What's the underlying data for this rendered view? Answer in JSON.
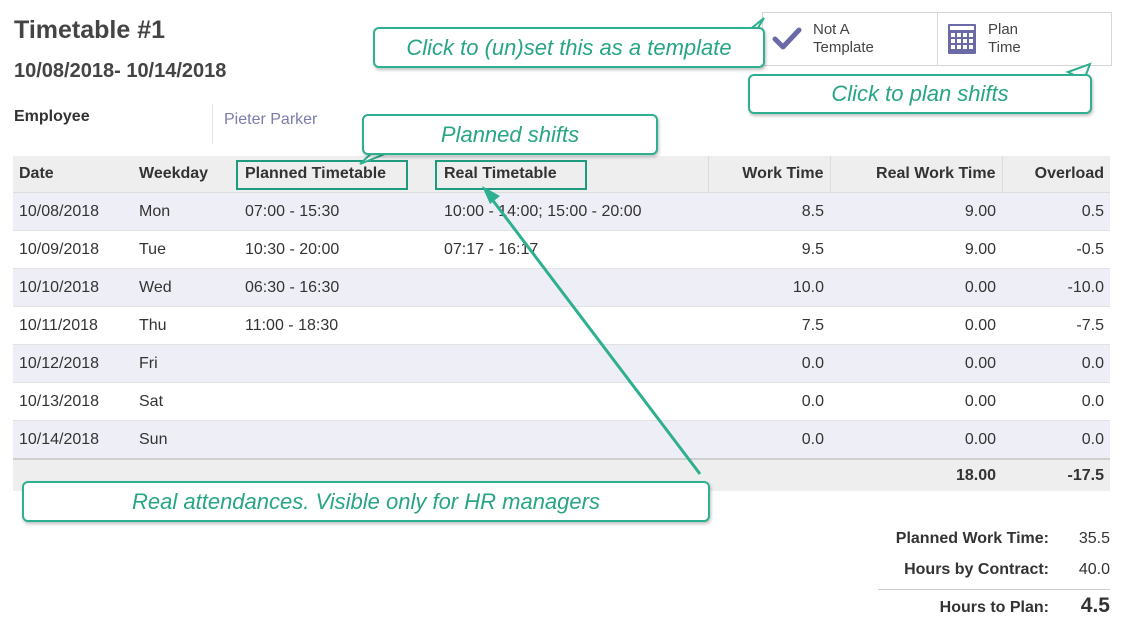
{
  "header": {
    "title": "Timetable #1",
    "date_range": "10/08/2018- 10/14/2018"
  },
  "employee": {
    "label": "Employee",
    "value": "Pieter Parker"
  },
  "buttons": {
    "template": {
      "line1": "Not A",
      "line2": "Template",
      "icon": "checkmark-icon"
    },
    "plan": {
      "line1": "Plan",
      "line2": "Time",
      "icon": "calendar-icon"
    }
  },
  "table": {
    "columns": [
      "Date",
      "Weekday",
      "Planned Timetable",
      "Real Timetable",
      "Work Time",
      "Real Work Time",
      "Overload"
    ],
    "rows": [
      [
        "10/08/2018",
        "Mon",
        "07:00 - 15:30",
        "10:00 - 14:00; 15:00 - 20:00",
        "8.5",
        "9.00",
        "0.5"
      ],
      [
        "10/09/2018",
        "Tue",
        "10:30 - 20:00",
        "07:17 - 16:17",
        "9.5",
        "9.00",
        "-0.5"
      ],
      [
        "10/10/2018",
        "Wed",
        "06:30 - 16:30",
        "",
        "10.0",
        "0.00",
        "-10.0"
      ],
      [
        "10/11/2018",
        "Thu",
        "11:00 - 18:30",
        "",
        "7.5",
        "0.00",
        "-7.5"
      ],
      [
        "10/12/2018",
        "Fri",
        "",
        "",
        "0.0",
        "0.00",
        "0.0"
      ],
      [
        "10/13/2018",
        "Sat",
        "",
        "",
        "0.0",
        "0.00",
        "0.0"
      ],
      [
        "10/14/2018",
        "Sun",
        "",
        "",
        "0.0",
        "0.00",
        "0.0"
      ]
    ],
    "totals": {
      "real_work_time": "18.00",
      "overload": "-17.5"
    }
  },
  "summary": {
    "planned_label": "Planned Work Time:",
    "planned_value": "35.5",
    "contract_label": "Hours by Contract:",
    "contract_value": "40.0",
    "toplan_label": "Hours to Plan:",
    "toplan_value": "4.5"
  },
  "callouts": {
    "template": "Click to (un)set this as a template",
    "plan": "Click to plan shifts",
    "planned": "Planned shifts",
    "real": "Real attendances. Visible only for HR  managers"
  },
  "colors": {
    "accent": "#2eaf90",
    "link": "#7c7bad",
    "row_stripe": "#eeeef6"
  }
}
